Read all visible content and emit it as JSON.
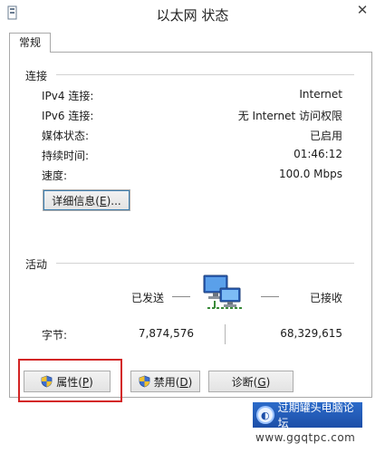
{
  "window": {
    "title": "以太网 状态"
  },
  "tabs": [
    {
      "label": "常规"
    }
  ],
  "connection": {
    "heading": "连接",
    "rows": [
      {
        "label": "IPv4 连接:",
        "value": "Internet"
      },
      {
        "label": "IPv6 连接:",
        "value": "无 Internet 访问权限"
      },
      {
        "label": "媒体状态:",
        "value": "已启用"
      },
      {
        "label": "持续时间:",
        "value": "01:46:12"
      },
      {
        "label": "速度:",
        "value": "100.0 Mbps"
      }
    ],
    "details_button": {
      "text": "详细信息(",
      "hotkey": "E",
      "suffix": ")..."
    }
  },
  "activity": {
    "heading": "活动",
    "sent_label": "已发送",
    "received_label": "已接收",
    "bytes_label": "字节:",
    "bytes_sent": "7,874,576",
    "bytes_received": "68,329,615"
  },
  "buttons": {
    "properties": {
      "text": "属性(",
      "hotkey": "P",
      "suffix": ")"
    },
    "disable": {
      "text": "禁用(",
      "hotkey": "D",
      "suffix": ")"
    },
    "diagnose": {
      "text": "诊断(",
      "hotkey": "G",
      "suffix": ")"
    }
  },
  "watermark": {
    "site_name": "过期罐头电脑论坛",
    "url": "www.ggqtpc.com"
  },
  "icons": {
    "app": "network-adapter-icon",
    "close": "close-icon",
    "network": "network-computers-icon",
    "shield": "uac-shield-icon"
  },
  "colors": {
    "highlight_box": "#d32424",
    "focus_border": "#3c7fb1"
  }
}
